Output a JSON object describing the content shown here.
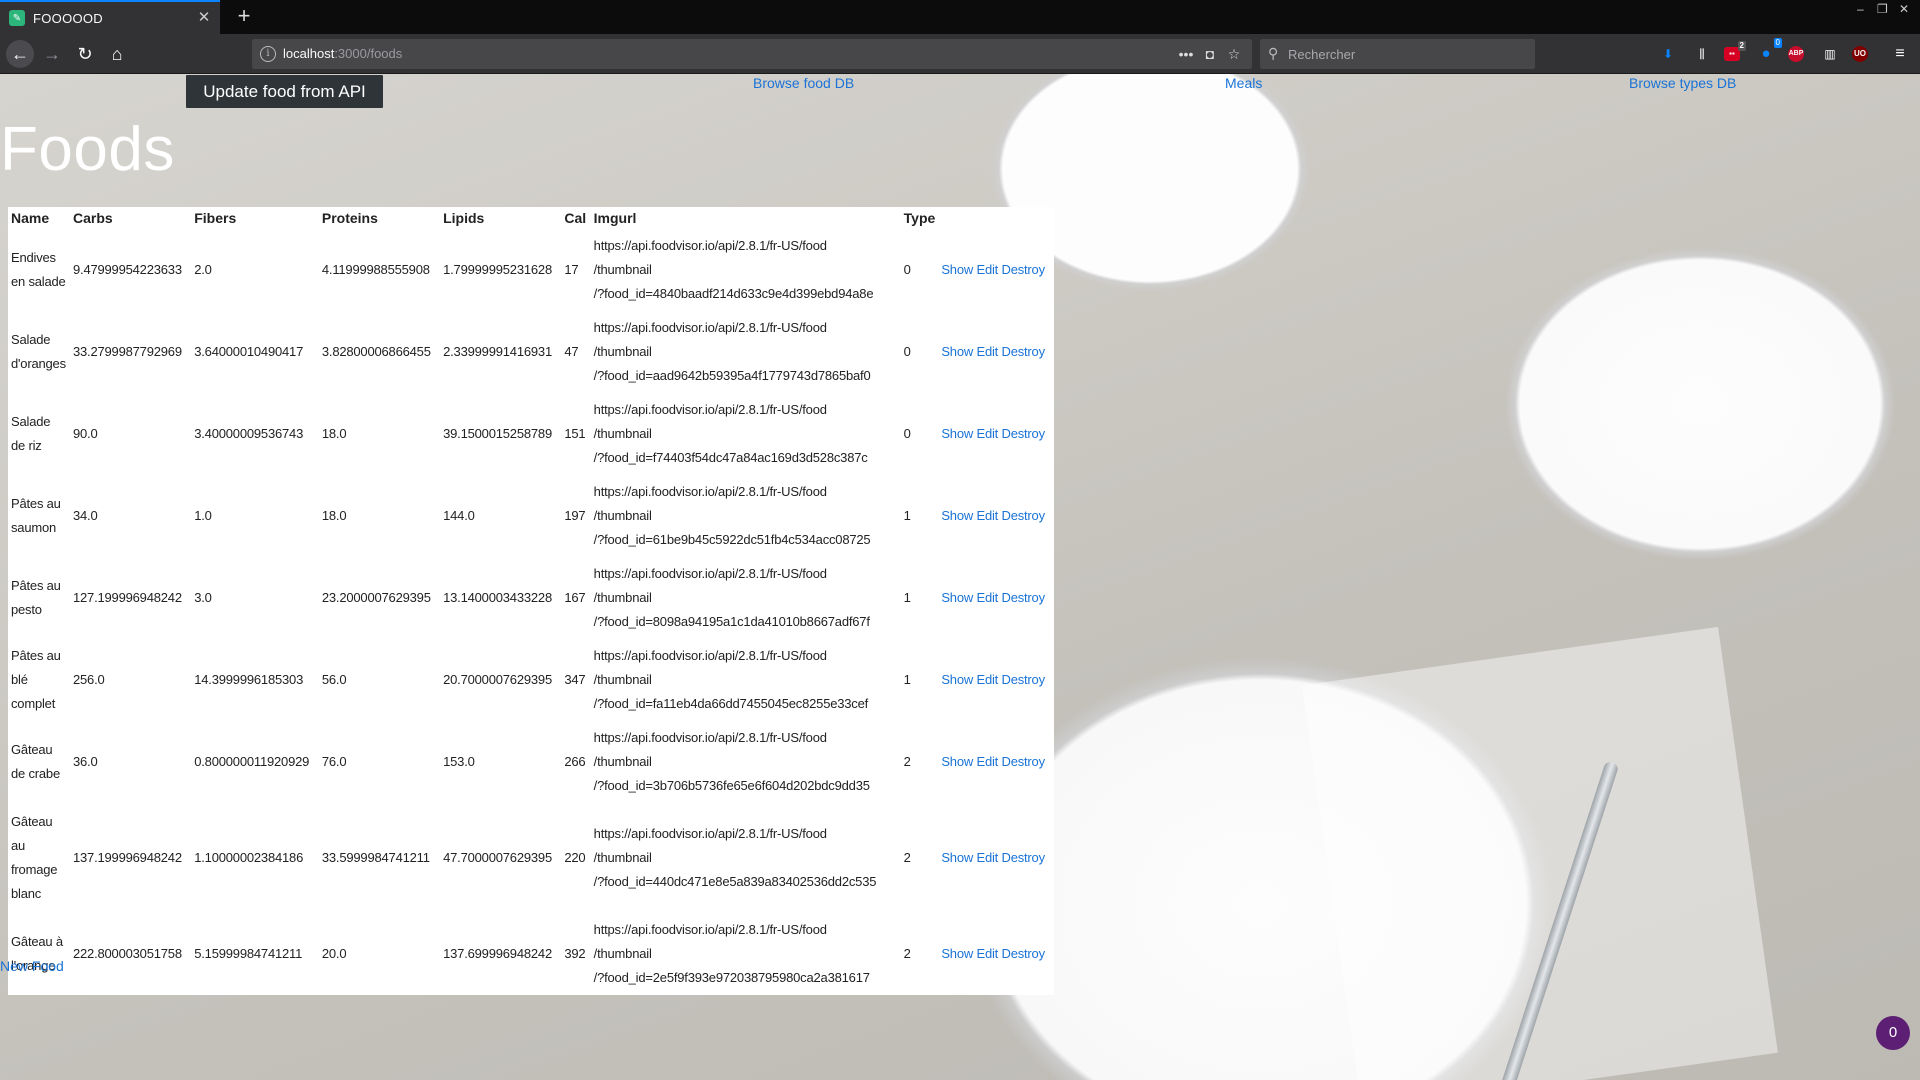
{
  "browser": {
    "tab_title": "FOOOOOD",
    "url_host": "localhost",
    "url_path": ":3000/foods",
    "search_placeholder": "Rechercher",
    "downloads_badge_count": "2",
    "ext_badge_count": "0",
    "abp_label": "ABP",
    "ub_label": "UO"
  },
  "page": {
    "update_button": "Update food from API",
    "nav_links": [
      "Browse food DB",
      "Meals",
      "Browse types DB"
    ],
    "title": "Foods",
    "new_food_link": "New Food",
    "fab_count": "0"
  },
  "table": {
    "headers": [
      "Name",
      "Carbs",
      "Fibers",
      "Proteins",
      "Lipids",
      "Cal",
      "Imgurl",
      "Type"
    ],
    "action_labels": [
      "Show",
      "Edit",
      "Destroy"
    ],
    "rows": [
      {
        "name": "Endives en salade",
        "carbs": "9.47999954223633",
        "fibers": "2.0",
        "proteins": "4.11999988555908",
        "lipids": "1.79999995231628",
        "cal": "17",
        "imgurl_1": "https://api.foodvisor.io/api/2.8.1/fr-US/food",
        "imgurl_2": "/thumbnail",
        "imgurl_3": "/?food_id=4840baadf214d633c9e4d399ebd94a8e",
        "type": "0"
      },
      {
        "name": "Salade d'oranges",
        "carbs": "33.2799987792969",
        "fibers": "3.64000010490417",
        "proteins": "3.82800006866455",
        "lipids": "2.33999991416931",
        "cal": "47",
        "imgurl_1": "https://api.foodvisor.io/api/2.8.1/fr-US/food",
        "imgurl_2": "/thumbnail",
        "imgurl_3": "/?food_id=aad9642b59395a4f1779743d7865baf0",
        "type": "0"
      },
      {
        "name": "Salade de riz",
        "carbs": "90.0",
        "fibers": "3.40000009536743",
        "proteins": "18.0",
        "lipids": "39.1500015258789",
        "cal": "151",
        "imgurl_1": "https://api.foodvisor.io/api/2.8.1/fr-US/food",
        "imgurl_2": "/thumbnail",
        "imgurl_3": "/?food_id=f74403f54dc47a84ac169d3d528c387c",
        "type": "0"
      },
      {
        "name": "Pâtes au saumon",
        "carbs": "34.0",
        "fibers": "1.0",
        "proteins": "18.0",
        "lipids": "144.0",
        "cal": "197",
        "imgurl_1": "https://api.foodvisor.io/api/2.8.1/fr-US/food",
        "imgurl_2": "/thumbnail",
        "imgurl_3": "/?food_id=61be9b45c5922dc51fb4c534acc08725",
        "type": "1"
      },
      {
        "name": "Pâtes au pesto",
        "carbs": "127.199996948242",
        "fibers": "3.0",
        "proteins": "23.2000007629395",
        "lipids": "13.1400003433228",
        "cal": "167",
        "imgurl_1": "https://api.foodvisor.io/api/2.8.1/fr-US/food",
        "imgurl_2": "/thumbnail",
        "imgurl_3": "/?food_id=8098a94195a1c1da41010b8667adf67f",
        "type": "1"
      },
      {
        "name": "Pâtes au blé complet",
        "carbs": "256.0",
        "fibers": "14.3999996185303",
        "proteins": "56.0",
        "lipids": "20.7000007629395",
        "cal": "347",
        "imgurl_1": "https://api.foodvisor.io/api/2.8.1/fr-US/food",
        "imgurl_2": "/thumbnail",
        "imgurl_3": "/?food_id=fa11eb4da66dd7455045ec8255e33cef",
        "type": "1"
      },
      {
        "name": "Gâteau de crabe",
        "carbs": "36.0",
        "fibers": "0.800000011920929",
        "proteins": "76.0",
        "lipids": "153.0",
        "cal": "266",
        "imgurl_1": "https://api.foodvisor.io/api/2.8.1/fr-US/food",
        "imgurl_2": "/thumbnail",
        "imgurl_3": "/?food_id=3b706b5736fe65e6f604d202bdc9dd35",
        "type": "2"
      },
      {
        "name": "Gâteau au fromage blanc",
        "carbs": "137.199996948242",
        "fibers": "1.10000002384186",
        "proteins": "33.5999984741211",
        "lipids": "47.7000007629395",
        "cal": "220",
        "imgurl_1": "https://api.foodvisor.io/api/2.8.1/fr-US/food",
        "imgurl_2": "/thumbnail",
        "imgurl_3": "/?food_id=440dc471e8e5a839a83402536dd2c535",
        "type": "2"
      },
      {
        "name": "Gâteau à l'orange",
        "carbs": "222.800003051758",
        "fibers": "5.15999984741211",
        "proteins": "20.0",
        "lipids": "137.699996948242",
        "cal": "392",
        "imgurl_1": "https://api.foodvisor.io/api/2.8.1/fr-US/food",
        "imgurl_2": "/thumbnail",
        "imgurl_3": "/?food_id=2e5f9f393e972038795980ca2a381617",
        "type": "2"
      }
    ]
  },
  "colors": {
    "link": "#1a73d6",
    "tab_accent": "#0a84ff",
    "fab": "#5c1f73"
  }
}
